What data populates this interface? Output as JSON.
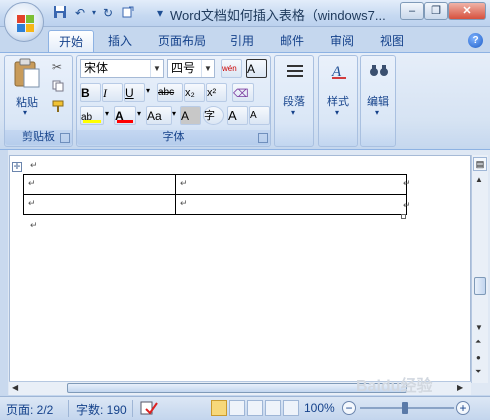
{
  "window": {
    "title": "Word文档如何插入表格（windows7...",
    "controls": {
      "minimize": "–",
      "restore": "❐",
      "close": "✕"
    }
  },
  "quick_access": {
    "undo": "↶",
    "redo": "↻",
    "customize": "▾"
  },
  "tabs": [
    {
      "label": "开始",
      "active": true
    },
    {
      "label": "插入"
    },
    {
      "label": "页面布局"
    },
    {
      "label": "引用"
    },
    {
      "label": "邮件"
    },
    {
      "label": "审阅"
    },
    {
      "label": "视图"
    }
  ],
  "help": "?",
  "ribbon": {
    "clipboard": {
      "group_label": "剪贴板",
      "paste_label": "粘贴"
    },
    "font": {
      "group_label": "字体",
      "font_name": "宋体",
      "font_size": "四号",
      "phonetic": "wén",
      "bold": "B",
      "italic": "I",
      "underline": "U",
      "strike": "abc",
      "subscript": "x₂",
      "superscript": "x²",
      "highlight": "ab",
      "font_color": "A",
      "change_case": "Aa",
      "char_shading": "A",
      "enclose": "字",
      "grow": "A",
      "shrink": "A"
    },
    "paragraph": {
      "group_label": "段落"
    },
    "styles": {
      "group_label": "样式"
    },
    "editing": {
      "group_label": "编辑"
    }
  },
  "document": {
    "paragraph_mark": "↵",
    "table": {
      "rows": 2,
      "cols": 2
    }
  },
  "status": {
    "page": "页面: 2/2",
    "words": "字数: 190",
    "zoom": "100%",
    "zoom_minus": "−",
    "zoom_plus": "+"
  },
  "watermark": {
    "text": "Baidu经验",
    "sub": "jingyan.baidu.com"
  },
  "colors": {
    "ribbon": "#d6e3f3",
    "accent": "#15428b",
    "highlight": "#ffff00",
    "font_red": "#ff0000"
  }
}
